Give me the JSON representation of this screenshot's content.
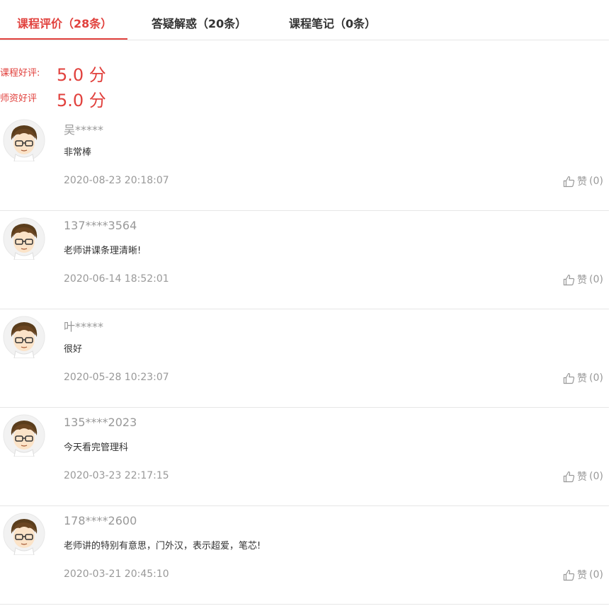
{
  "tabs": [
    {
      "label": "课程评价（28条）",
      "active": true
    },
    {
      "label": "答疑解惑（20条）",
      "active": false
    },
    {
      "label": "课程笔记（0条）",
      "active": false
    }
  ],
  "ratings": [
    {
      "label": "课程好评:",
      "value": "5.0 分"
    },
    {
      "label": "师资好评",
      "value": "5.0 分"
    }
  ],
  "like_label": "赞",
  "reviews": [
    {
      "user": "吴*****",
      "content": "非常棒",
      "time": "2020-08-23 20:18:07",
      "likes": "(0)",
      "avatar_icon": "cartoon-boy-glasses"
    },
    {
      "user": "137****3564",
      "content": "老师讲课条理清晰!",
      "time": "2020-06-14 18:52:01",
      "likes": "(0)",
      "avatar_icon": "cartoon-boy-glasses"
    },
    {
      "user": "叶*****",
      "content": "很好",
      "time": "2020-05-28 10:23:07",
      "likes": "(0)",
      "avatar_icon": "cartoon-boy-glasses"
    },
    {
      "user": "135****2023",
      "content": "今天看完管理科",
      "time": "2020-03-23 22:17:15",
      "likes": "(0)",
      "avatar_icon": "cartoon-boy-glasses"
    },
    {
      "user": "178****2600",
      "content": "老师讲的特别有意思，门外汉，表示超爱，笔芯!",
      "time": "2020-03-21 20:45:10",
      "likes": "(0)",
      "avatar_icon": "cartoon-boy-glasses"
    }
  ],
  "colors": {
    "accent": "#e1413d",
    "muted": "#999999",
    "text": "#333333",
    "divider": "#e6e6e6"
  }
}
